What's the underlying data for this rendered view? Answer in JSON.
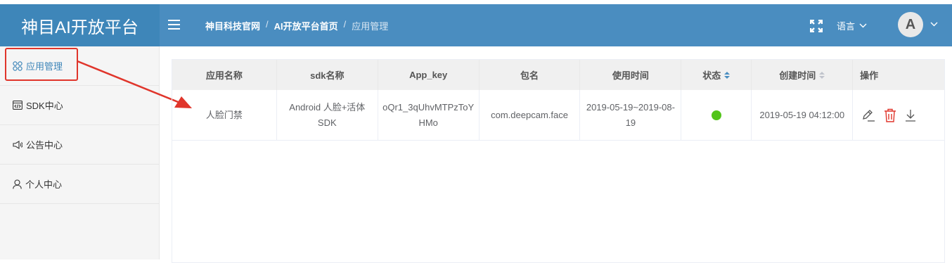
{
  "app": {
    "title": "神目AI开放平台"
  },
  "breadcrumb": {
    "items": [
      "神目科技官网",
      "AI开放平台首页"
    ],
    "current": "应用管理",
    "separator": "/"
  },
  "header": {
    "language_label": "语言",
    "avatar_letter": "A"
  },
  "sidebar": {
    "items": [
      {
        "label": "应用管理",
        "icon": "grid-icon",
        "active": true
      },
      {
        "label": "SDK中心",
        "icon": "code-icon"
      },
      {
        "label": "公告中心",
        "icon": "megaphone-icon"
      },
      {
        "label": "个人中心",
        "icon": "user-icon"
      }
    ]
  },
  "table": {
    "headers": [
      "应用名称",
      "sdk名称",
      "App_key",
      "包名",
      "使用时间",
      "状态",
      "创建时间",
      "操作"
    ],
    "rows": [
      {
        "app_name": "人脸门禁",
        "sdk_name": "Android 人脸+活体SDK",
        "app_key": "oQr1_3qUhvMTPzToYHMo",
        "package": "com.deepcam.face",
        "usage_time": "2019-05-19~2019-08-19",
        "status_color": "#52c41a",
        "created": "2019-05-19 04:12:00"
      }
    ]
  },
  "colors": {
    "header_bg": "#4a8dc0",
    "logo_bg": "#3e86b9",
    "annotation": "#e0352b",
    "delete_icon": "#e0352b"
  }
}
